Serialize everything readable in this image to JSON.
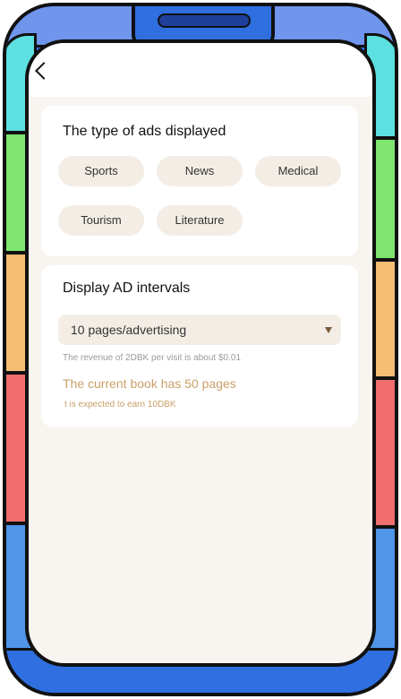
{
  "header": {
    "back_label": ""
  },
  "ads_type": {
    "title": "The type of ads displayed",
    "tags": [
      "Sports",
      "News",
      "Medical",
      "Tourism",
      "Literature"
    ]
  },
  "ad_interval": {
    "title": "Display AD intervals",
    "selected": "10 pages/advertising",
    "note": "The revenue of 2DBK per visit is about $0.01",
    "current_book": "The current book has 50 pages",
    "earn": "t is expected to earn 10DBK"
  },
  "colors": {
    "accent_text": "#caa06a",
    "tag_bg": "#f3ede6",
    "screen_bg": "#f8f5f0",
    "frame_blue": "#2f6fe0"
  }
}
